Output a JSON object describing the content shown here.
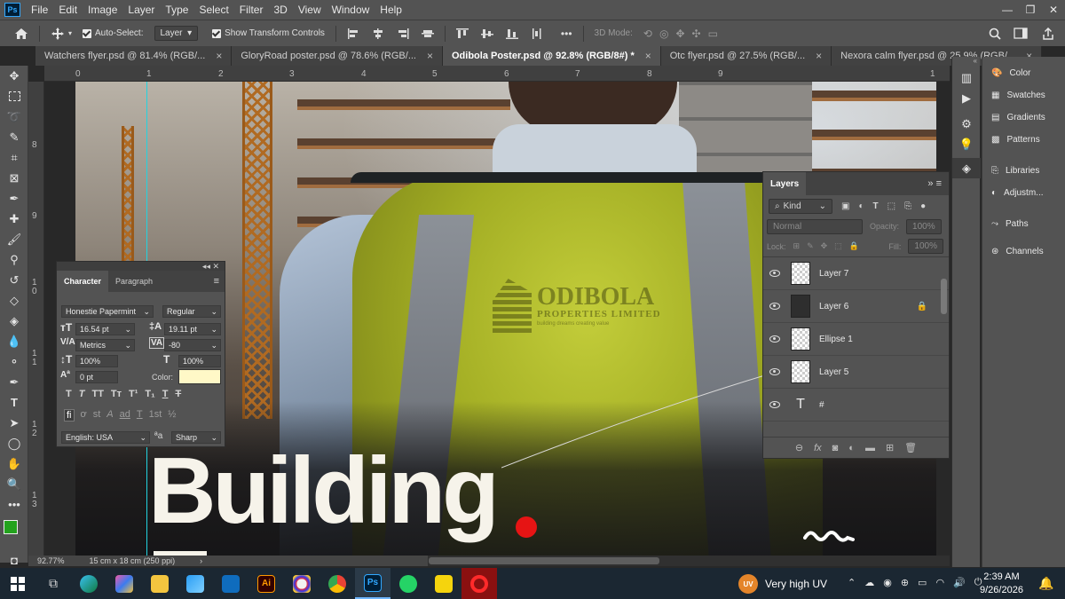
{
  "app": {
    "logo_text": "Ps",
    "menu": [
      "File",
      "Edit",
      "Image",
      "Layer",
      "Type",
      "Select",
      "Filter",
      "3D",
      "View",
      "Window",
      "Help"
    ],
    "window_controls": [
      "—",
      "❐",
      "✕"
    ]
  },
  "options_bar": {
    "auto_select_label": "Auto-Select:",
    "auto_select_target": "Layer",
    "show_transform_label": "Show Transform Controls",
    "mode_3d_label": "3D Mode:",
    "more": "•••"
  },
  "tabs": [
    {
      "label": "Watchers flyer.psd @ 81.4% (RGB/...",
      "active": false
    },
    {
      "label": "GloryRoad poster.psd @ 78.6% (RGB/...",
      "active": false
    },
    {
      "label": "Odibola Poster.psd @ 92.8% (RGB/8#) *",
      "active": true
    },
    {
      "label": "Otc flyer.psd @ 27.5% (RGB/...",
      "active": false
    },
    {
      "label": "Nexora calm flyer.psd @ 25.9% (RGB/...",
      "active": false
    }
  ],
  "tab_close": "×",
  "rulers": {
    "top": [
      "0",
      "1",
      "2",
      "3",
      "4",
      "5",
      "6",
      "7",
      "8",
      "9",
      "1"
    ],
    "left": [
      "8",
      "9",
      "1\n0",
      "1\n1",
      "1\n2",
      "1\n3"
    ]
  },
  "canvas": {
    "logo_name": "ODIBOLA",
    "logo_sub": "PROPERTIES LIMITED",
    "logo_tag": "building dreams creating value",
    "headline": "Building",
    "accent_color": "#e61414"
  },
  "character_panel": {
    "collapse": "◂◂ ✕",
    "tabs": [
      "Character",
      "Paragraph"
    ],
    "font_family": "Honestie Papermint",
    "font_style": "Regular",
    "font_size": "16.54 pt",
    "leading": "19.11 pt",
    "kerning": "Metrics",
    "tracking": "-80",
    "vertical_scale": "100%",
    "horizontal_scale": "100%",
    "baseline_shift": "0 pt",
    "color_label": "Color:",
    "color_value": "#fff8c7",
    "style_buttons": [
      "T",
      "T",
      "TT",
      "Tт",
      "T¹",
      "T₁",
      "T",
      "T"
    ],
    "opentype_buttons": [
      "fi",
      "ơ",
      "st",
      "A",
      "ad",
      "T",
      "1st",
      "½"
    ],
    "language": "English: USA",
    "aa_label": "ªa",
    "antialias": "Sharp"
  },
  "layers_panel": {
    "title": "Layers",
    "kind_label": "Kind",
    "blend_mode": "Normal",
    "opacity_label": "Opacity:",
    "opacity_value": "100%",
    "lock_label": "Lock:",
    "fill_label": "Fill:",
    "fill_value": "100%",
    "layers": [
      {
        "name": "Layer 7",
        "locked": false
      },
      {
        "name": "Layer 6",
        "locked": true
      },
      {
        "name": "Ellipse 1",
        "locked": false
      },
      {
        "name": "Layer 5",
        "locked": false
      },
      {
        "name": "#",
        "locked": false,
        "type": "text"
      }
    ]
  },
  "right_panel": {
    "items": [
      "Color",
      "Swatches",
      "Gradients",
      "Patterns",
      "Libraries",
      "Adjustm...",
      "Paths",
      "Channels"
    ]
  },
  "status": {
    "zoom": "92.77%",
    "doc_info": "15 cm x 18 cm (250 ppi)"
  },
  "taskbar": {
    "weather_badge": "UV",
    "weather": "Very high UV",
    "time": "2:39 AM",
    "date": "9/26/2026"
  }
}
